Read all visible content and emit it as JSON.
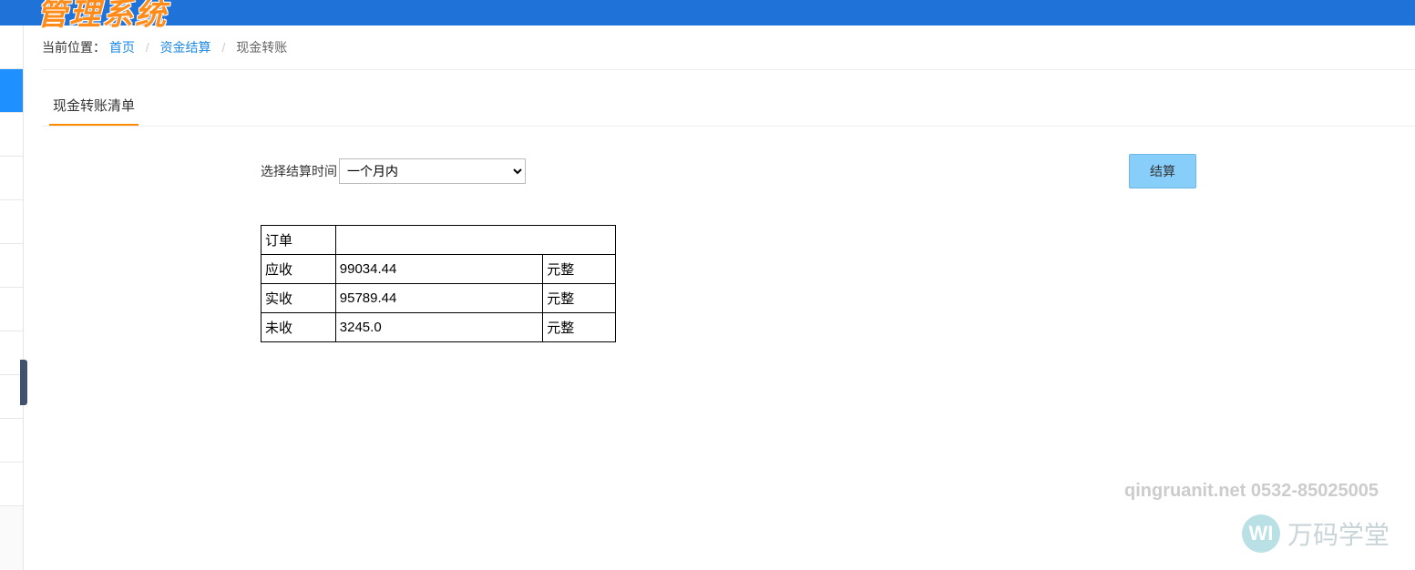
{
  "header": {
    "logo_text": "管理系统"
  },
  "breadcrumb": {
    "label": "当前位置：",
    "home": "首页",
    "section": "资金结算",
    "current": "现金转账"
  },
  "tab": {
    "title": "现金转账清单"
  },
  "filter": {
    "label": "选择结算时间",
    "selected": "一个月内"
  },
  "actions": {
    "settle": "结算"
  },
  "table": {
    "row0_label": "订单",
    "row0_value": "",
    "row1_label": "应收",
    "row1_value": "99034.44",
    "row1_unit": "元整",
    "row2_label": "实收",
    "row2_value": "95789.44",
    "row2_unit": "元整",
    "row3_label": "未收",
    "row3_value": "3245.0",
    "row3_unit": "元整"
  },
  "footer": {
    "contact": "qingruanit.net 0532-85025005",
    "brand": "万码学堂",
    "brand_icon": "WI"
  }
}
